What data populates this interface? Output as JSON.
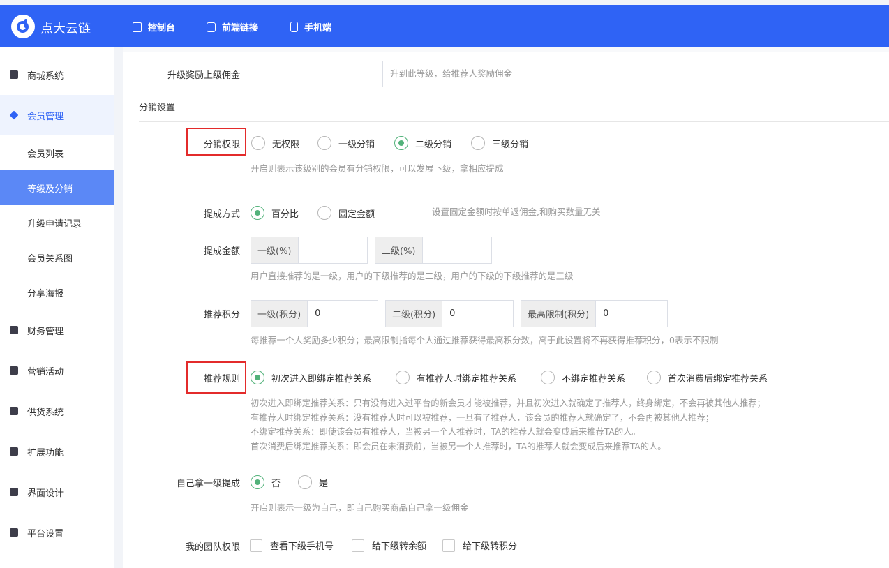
{
  "brand": {
    "name": "点大云链"
  },
  "topnav": [
    {
      "label": "控制台"
    },
    {
      "label": "前端链接"
    },
    {
      "label": "手机端"
    }
  ],
  "sidebar": {
    "items": [
      {
        "label": "商城系统",
        "icon": "bag-icon"
      },
      {
        "label": "会员管理",
        "icon": "diamond-icon"
      },
      {
        "label": "财务管理",
        "icon": "yen-icon"
      },
      {
        "label": "营销活动",
        "icon": "gift-icon"
      },
      {
        "label": "供货系统",
        "icon": "truck-icon"
      },
      {
        "label": "扩展功能",
        "icon": "puzzle-icon"
      },
      {
        "label": "界面设计",
        "icon": "layout-icon"
      },
      {
        "label": "平台设置",
        "icon": "monitor-icon"
      }
    ],
    "sub_items": [
      {
        "label": "会员列表"
      },
      {
        "label": "等级及分销"
      },
      {
        "label": "升级申请记录"
      },
      {
        "label": "会员关系图"
      },
      {
        "label": "分享海报"
      }
    ]
  },
  "form": {
    "upgrade_reward": {
      "label": "升级奖励上级佣金",
      "value": "",
      "hint": "升到此等级，给推荐人奖励佣金"
    },
    "section_title": "分销设置",
    "dist_permission": {
      "label": "分销权限",
      "options": [
        "无权限",
        "一级分销",
        "二级分销",
        "三级分销"
      ],
      "selected": "二级分销",
      "hint": "开启则表示该级别的会员有分销权限，可以发展下级，拿相应提成"
    },
    "commission_mode": {
      "label": "提成方式",
      "options": [
        "百分比",
        "固定金额"
      ],
      "selected": "百分比",
      "hint": "设置固定金额时按单返佣金,和购买数量无关"
    },
    "commission_amount": {
      "label": "提成金额",
      "fields": [
        {
          "prefix": "一级(%)",
          "value": ""
        },
        {
          "prefix": "二级(%)",
          "value": ""
        }
      ],
      "hint": "用户直接推荐的是一级，用户的下级推荐的是二级，用户的下级的下级推荐的是三级"
    },
    "referral_points": {
      "label": "推荐积分",
      "fields": [
        {
          "prefix": "一级(积分)",
          "value": "0"
        },
        {
          "prefix": "二级(积分)",
          "value": "0"
        },
        {
          "prefix": "最高限制(积分)",
          "value": "0"
        }
      ],
      "hint": "每推荐一个人奖励多少积分；最高限制指每个人通过推荐获得最高积分数，高于此设置将不再获得推荐积分，0表示不限制"
    },
    "referral_rule": {
      "label": "推荐规则",
      "options": [
        "初次进入即绑定推荐关系",
        "有推荐人时绑定推荐关系",
        "不绑定推荐关系",
        "首次消费后绑定推荐关系"
      ],
      "selected": "初次进入即绑定推荐关系",
      "hints": [
        "初次进入即绑定推荐关系：只有没有进入过平台的新会员才能被推荐，并且初次进入就确定了推荐人，终身绑定，不会再被其他人推荐；",
        "有推荐人时绑定推荐关系：没有推荐人时可以被推荐，一旦有了推荐人，该会员的推荐人就确定了，不会再被其他人推荐；",
        "不绑定推荐关系：即使该会员有推荐人，当被另一个人推荐时，TA的推荐人就会变成后来推荐TA的人。",
        "首次消费后绑定推荐关系：即会员在未消费前，当被另一个人推荐时，TA的推荐人就会变成后来推荐TA的人。"
      ]
    },
    "self_commission": {
      "label": "自己拿一级提成",
      "options": [
        "否",
        "是"
      ],
      "selected": "否",
      "hint": "开启则表示一级为自己，即自己购买商品自己拿一级佣金"
    },
    "team_permission": {
      "label": "我的团队权限",
      "options": [
        "查看下级手机号",
        "给下级转余额",
        "给下级转积分"
      ]
    }
  },
  "colors": {
    "primary": "#2f63f5",
    "radio_checked": "#52b27a",
    "highlight_box": "#e32b2b",
    "sidebar_active": "#5b88f6"
  }
}
